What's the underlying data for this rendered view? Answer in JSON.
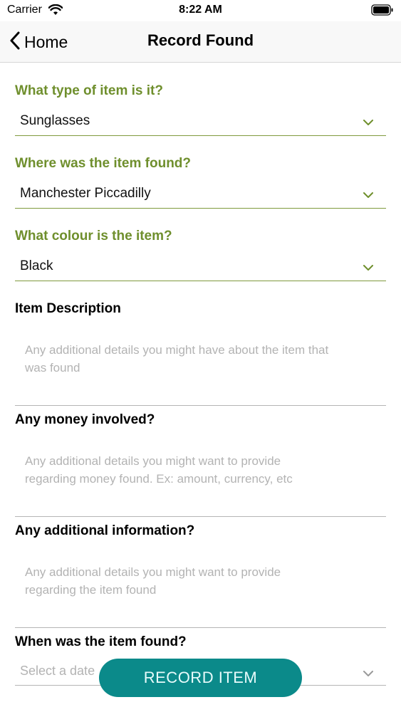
{
  "status_bar": {
    "carrier": "Carrier",
    "time": "8:22 AM"
  },
  "nav": {
    "back_label": "Home",
    "title": "Record Found"
  },
  "form": {
    "item_type": {
      "label": "What type of item is it?",
      "value": "Sunglasses"
    },
    "location": {
      "label": "Where was the item found?",
      "value": "Manchester Piccadilly"
    },
    "colour": {
      "label": "What colour is the item?",
      "value": "Black"
    },
    "description": {
      "label": "Item Description",
      "placeholder_line1": "Any additional details you might have about the item that",
      "placeholder_line2": "was found"
    },
    "money": {
      "label": "Any money involved?",
      "placeholder_line1": "Any additional details you might want to provide",
      "placeholder_line2": "regarding money found. Ex: amount, currency, etc"
    },
    "additional": {
      "label": "Any additional information?",
      "placeholder_line1": "Any additional details you might want to provide",
      "placeholder_line2": "regarding the item found"
    },
    "date": {
      "label": "When was the item found?",
      "placeholder": "Select a date"
    }
  },
  "record_button": {
    "label": "RECORD ITEM"
  },
  "colors": {
    "accent_green": "#6f8f2d",
    "button_teal": "#0b8a8a"
  },
  "icons": [
    "wifi-icon",
    "battery-icon",
    "back-chevron-icon",
    "chevron-down-icon"
  ]
}
